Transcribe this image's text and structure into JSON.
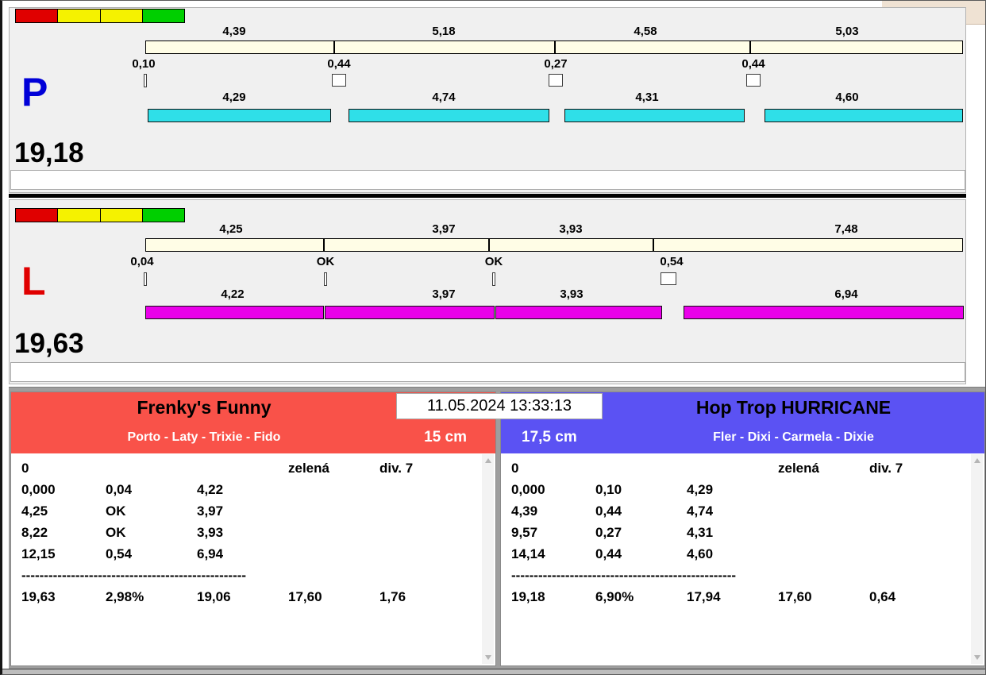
{
  "window": {
    "timestamp": "11.05.2024 13:33:13"
  },
  "lanes": [
    {
      "letter": "P",
      "total": "19,18",
      "splits": [
        "4,39",
        "5,18",
        "4,58",
        "5,03"
      ],
      "faults": [
        "0,10",
        "0,44",
        "0,27",
        "0,44"
      ],
      "dog_times": [
        "4,29",
        "4,74",
        "4,31",
        "4,60"
      ]
    },
    {
      "letter": "L",
      "total": "19,63",
      "splits": [
        "4,25",
        "3,97",
        "3,93",
        "7,48"
      ],
      "faults": [
        "0,04",
        "OK",
        "OK",
        "0,54"
      ],
      "dog_times": [
        "4,22",
        "3,97",
        "3,93",
        "6,94"
      ]
    }
  ],
  "teams": [
    {
      "name": "Frenky's Funny",
      "dogs": "Porto - Laty - Trixie - Fido",
      "jump_height": "15 cm",
      "rows": [
        [
          "0",
          "",
          "",
          "zelená",
          "div. 7"
        ],
        [
          "0,000",
          "0,04",
          "4,22",
          "",
          ""
        ],
        [
          "4,25",
          "OK",
          "3,97",
          "",
          ""
        ],
        [
          "8,22",
          "OK",
          "3,93",
          "",
          ""
        ],
        [
          "12,15",
          "0,54",
          "6,94",
          "",
          ""
        ]
      ],
      "separator": "--------------------------------------------------",
      "totals": [
        "19,63",
        "2,98%",
        "19,06",
        "17,60",
        "1,76"
      ]
    },
    {
      "name": "Hop Trop HURRICANE",
      "dogs": "Fler - Dixi - Carmela - Dixie",
      "jump_height": "17,5 cm",
      "rows": [
        [
          "0",
          "",
          "",
          "zelená",
          "div. 7"
        ],
        [
          "0,000",
          "0,10",
          "4,29",
          "",
          ""
        ],
        [
          "4,39",
          "0,44",
          "4,74",
          "",
          ""
        ],
        [
          "9,57",
          "0,27",
          "4,31",
          "",
          ""
        ],
        [
          "14,14",
          "0,44",
          "4,60",
          "",
          ""
        ]
      ],
      "separator": "--------------------------------------------------",
      "totals": [
        "19,18",
        "6,90%",
        "17,94",
        "17,60",
        "0,64"
      ]
    }
  ],
  "colors": {
    "traffic_lights": [
      "#e00000",
      "#f5f200",
      "#f5f200",
      "#00cf00"
    ],
    "split_bar": "#fffde6",
    "lane_p_bar": "#2fdfe8",
    "lane_l_bar": "#ea00ea",
    "lane_p_letter": "#0000d8",
    "lane_l_letter": "#e00000",
    "team_left_header": "#f95249",
    "team_right_header": "#5b52f3"
  }
}
